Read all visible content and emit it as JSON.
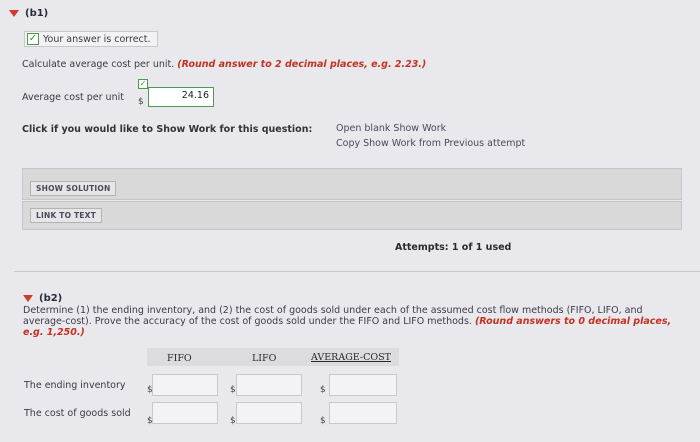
{
  "b1": {
    "header": "(b1)",
    "correct_text": "Your answer is correct.",
    "instruction": "Calculate average cost per unit.",
    "instruction_note": "(Round answer to 2 decimal places, e.g. 2.23.)",
    "field_label": "Average cost per unit",
    "currency": "$",
    "value": "24.16",
    "show_work_prompt": "Click if you would like to Show Work for this question:",
    "open_blank": "Open blank Show Work",
    "copy_previous": "Copy Show Work from Previous attempt",
    "show_solution": "SHOW SOLUTION",
    "link_to_text": "LINK TO TEXT",
    "attempts": "Attempts: 1 of 1 used"
  },
  "b2": {
    "header": "(b2)",
    "question": "Determine (1) the ending inventory, and (2) the cost of goods sold under each of the assumed cost flow methods (FIFO, LIFO, and average-cost). Prove the accuracy of the cost of goods sold under the FIFO and LIFO methods.",
    "question_note": "(Round answers to 0 decimal places, e.g. 1,250.)",
    "columns": [
      "FIFO",
      "LIFO",
      "AVERAGE-COST"
    ],
    "rows": [
      {
        "label": "The ending inventory",
        "currency": "$"
      },
      {
        "label": "The cost of goods sold",
        "currency": "$"
      }
    ]
  },
  "colors": {
    "accent_red": "#c23221",
    "correct_green": "#4f9a52",
    "background": "#e9e8ec"
  }
}
